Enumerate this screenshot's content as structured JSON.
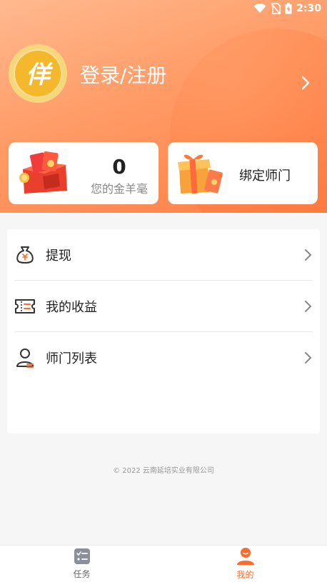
{
  "status_bar": {
    "time": "2:30"
  },
  "header": {
    "login_label": "登录/注册",
    "avatar_text": "佯"
  },
  "cards": {
    "coins": {
      "value": "0",
      "label": "您的金羊毫"
    },
    "bind": {
      "label": "绑定师门"
    }
  },
  "menu": {
    "items": [
      {
        "label": "提现",
        "icon": "money-bag-icon"
      },
      {
        "label": "我的收益",
        "icon": "ticket-icon"
      },
      {
        "label": "师门列表",
        "icon": "person-list-icon"
      }
    ]
  },
  "footer": {
    "copyright": "© 2022  云南延培实业有限公司"
  },
  "tabbar": {
    "tabs": [
      {
        "label": "任务",
        "icon": "checklist-icon"
      },
      {
        "label": "我的",
        "icon": "user-icon",
        "active": true
      }
    ]
  },
  "colors": {
    "accent": "#ff6a2a",
    "header_gradient_start": "#ffb98f",
    "header_gradient_end": "#ff7f45"
  }
}
